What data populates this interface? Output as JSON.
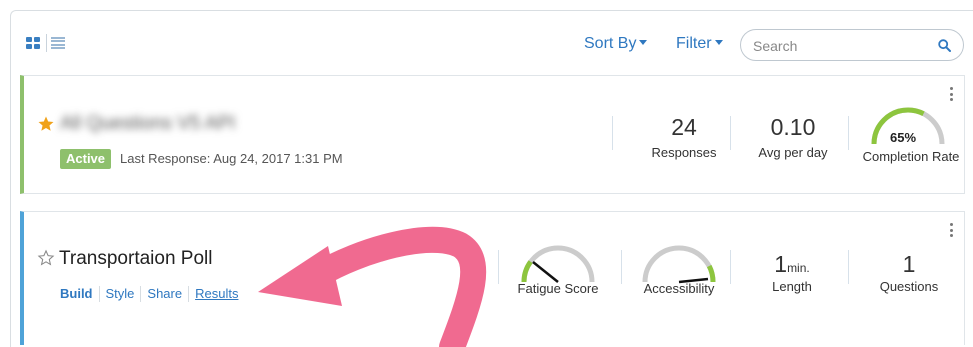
{
  "toolbar": {
    "sort_label": "Sort By",
    "filter_label": "Filter",
    "search_placeholder": "Search"
  },
  "surveys": [
    {
      "title": "All Questions V5 API",
      "starred": true,
      "status": "Active",
      "last_response": "Last Response: Aug 24, 2017 1:31 PM",
      "stats": {
        "responses_value": "24",
        "responses_label": "Responses",
        "avg_value": "0.10",
        "avg_label": "Avg per day",
        "completion_value": "65%",
        "completion_fraction": 0.65,
        "completion_label": "Completion Rate"
      }
    },
    {
      "title": "Transportaion Poll",
      "starred": false,
      "links": [
        "Build",
        "Style",
        "Share",
        "Results"
      ],
      "stats": {
        "fatigue_label": "Fatigue Score",
        "accessibility_label": "Accessibility",
        "length_value": "1",
        "length_unit": "min.",
        "length_label": "Length",
        "questions_value": "1",
        "questions_label": "Questions"
      }
    }
  ],
  "colors": {
    "accent": "#2f78c0",
    "active_green": "#8ec06c",
    "selected_blue": "#4fa3d8",
    "star_gold": "#f0a21a",
    "gauge_green": "#8dc53e",
    "arrow_pink": "#f06a90"
  }
}
